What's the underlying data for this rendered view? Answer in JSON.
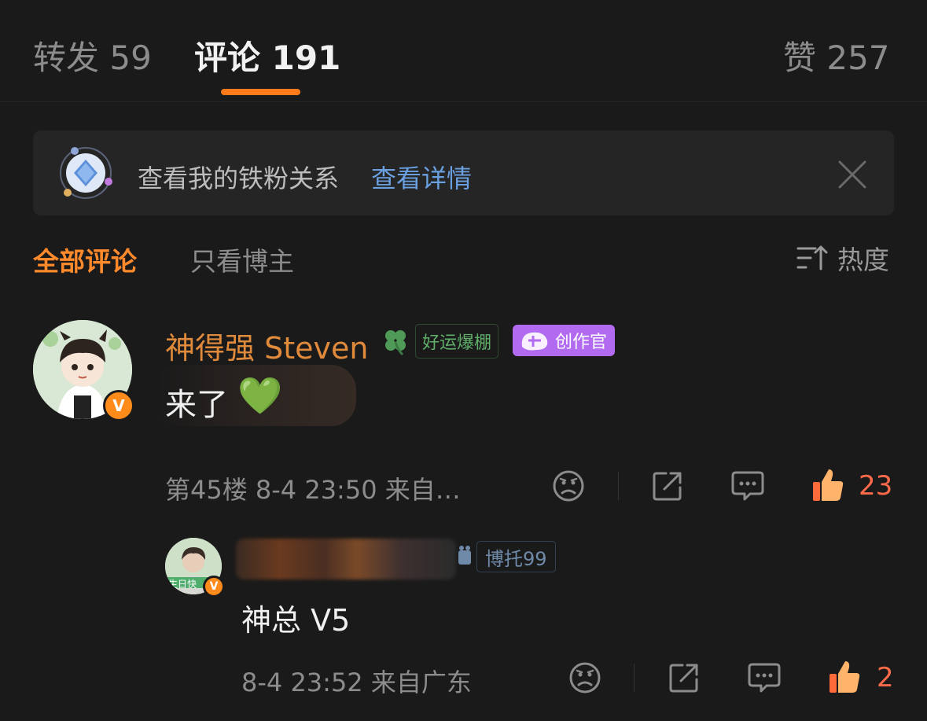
{
  "tabs": {
    "repost": "转发 59",
    "comments": "评论 191",
    "likes": "赞 257"
  },
  "banner": {
    "text": "查看我的铁粉关系",
    "link": "查看详情"
  },
  "filters": {
    "all": "全部评论",
    "blogger_only": "只看博主",
    "sort": "热度"
  },
  "comment": {
    "username": "神得强 Steven",
    "tag_lucky": "好运爆棚",
    "tag_creator": "创作官",
    "text": "来了",
    "emoji": "💚",
    "meta": "第45楼  8-4 23:50  来自…",
    "likes": "23",
    "avatar_badge": "V"
  },
  "reply": {
    "tag": "博托99",
    "avatar_text": "生日快",
    "text": "神总 V5",
    "meta": "8-4 23:52  来自广东",
    "likes": "2",
    "avatar_badge": "V"
  },
  "colors": {
    "accent_orange": "#ff7a1a",
    "link_blue": "#6a9fe0",
    "creator_purple": "#b26bf0",
    "like_red": "#ff6a4a"
  }
}
